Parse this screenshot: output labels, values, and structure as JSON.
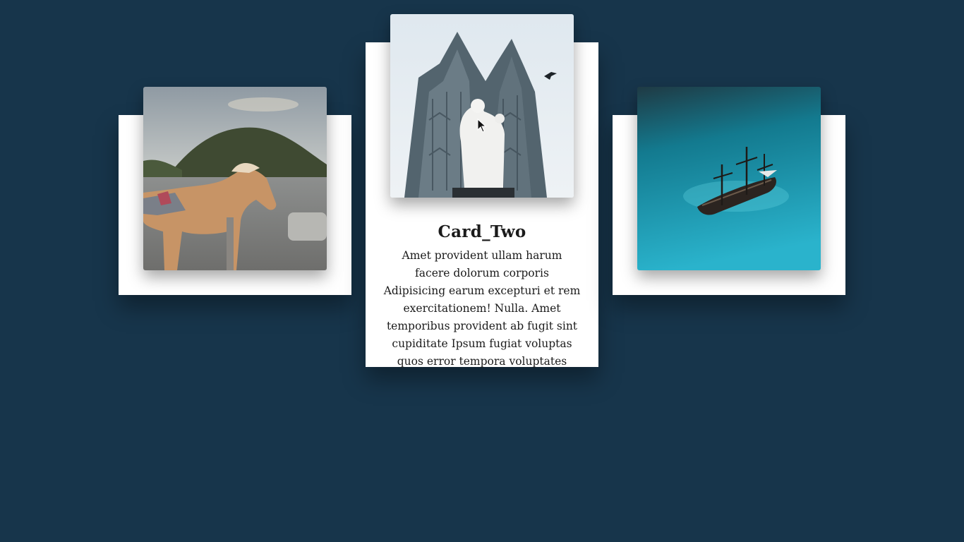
{
  "page": {
    "background_color": "#17354b"
  },
  "cards": [
    {
      "id": "card-one",
      "image": "horse-on-sandy-plain-with-hill",
      "expanded": false
    },
    {
      "id": "card-two",
      "image": "gothic-cathedral-with-white-statue",
      "expanded": true,
      "title": "Card_Two",
      "text": "Amet provident ullam harum facere dolorum corporis Adipisicing earum excepturi et rem exercitationem! Nulla. Amet temporibus provident ab fugit sint cupiditate Ipsum fugiat voluptas quos error tempora voluptates"
    },
    {
      "id": "card-three",
      "image": "sailing-ship-on-turquoise-water",
      "expanded": false
    }
  ],
  "cursor": "arrow-pointer-icon"
}
